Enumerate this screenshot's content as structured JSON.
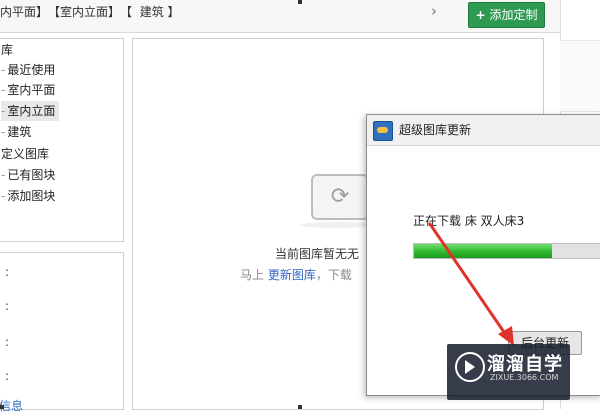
{
  "breadcrumb": {
    "items": [
      "内平面】",
      "【室内立面】",
      "【",
      "建筑",
      "】"
    ]
  },
  "toolbar": {
    "next_icon": "chevron-right-icon",
    "add_custom_label": "添加定制",
    "add_icon": "plus-icon",
    "add_color": "#2f9a52"
  },
  "tree": {
    "items": [
      {
        "label": "库",
        "prefix": ""
      },
      {
        "label": "最近使用",
        "prefix": "-"
      },
      {
        "label": "室内平面",
        "prefix": "-"
      },
      {
        "label": "室内立面",
        "prefix": "-",
        "selected": true
      },
      {
        "label": "建筑",
        "prefix": "-"
      },
      {
        "label": "定义图库",
        "prefix": ""
      },
      {
        "label": "已有图块",
        "prefix": "-"
      },
      {
        "label": "添加图块",
        "prefix": "-"
      }
    ]
  },
  "list": {
    "colons": [
      ":",
      ":",
      ":",
      ":"
    ],
    "link": "信息"
  },
  "empty_state": {
    "icon": "refresh-icon",
    "title": "当前图库暂无无",
    "sub_prefix": "马上 ",
    "sub_link": "更新图库",
    "sub_suffix": "，下载"
  },
  "dialog": {
    "title": "超级图库更新",
    "status_text": "正在下载 床 双人床3",
    "progress": 0.74,
    "progress_color": "#2bb52b",
    "cancel_label": "后台更新"
  },
  "watermark": {
    "name": "溜溜自学",
    "url": "ZIXUE.3066.COM"
  }
}
